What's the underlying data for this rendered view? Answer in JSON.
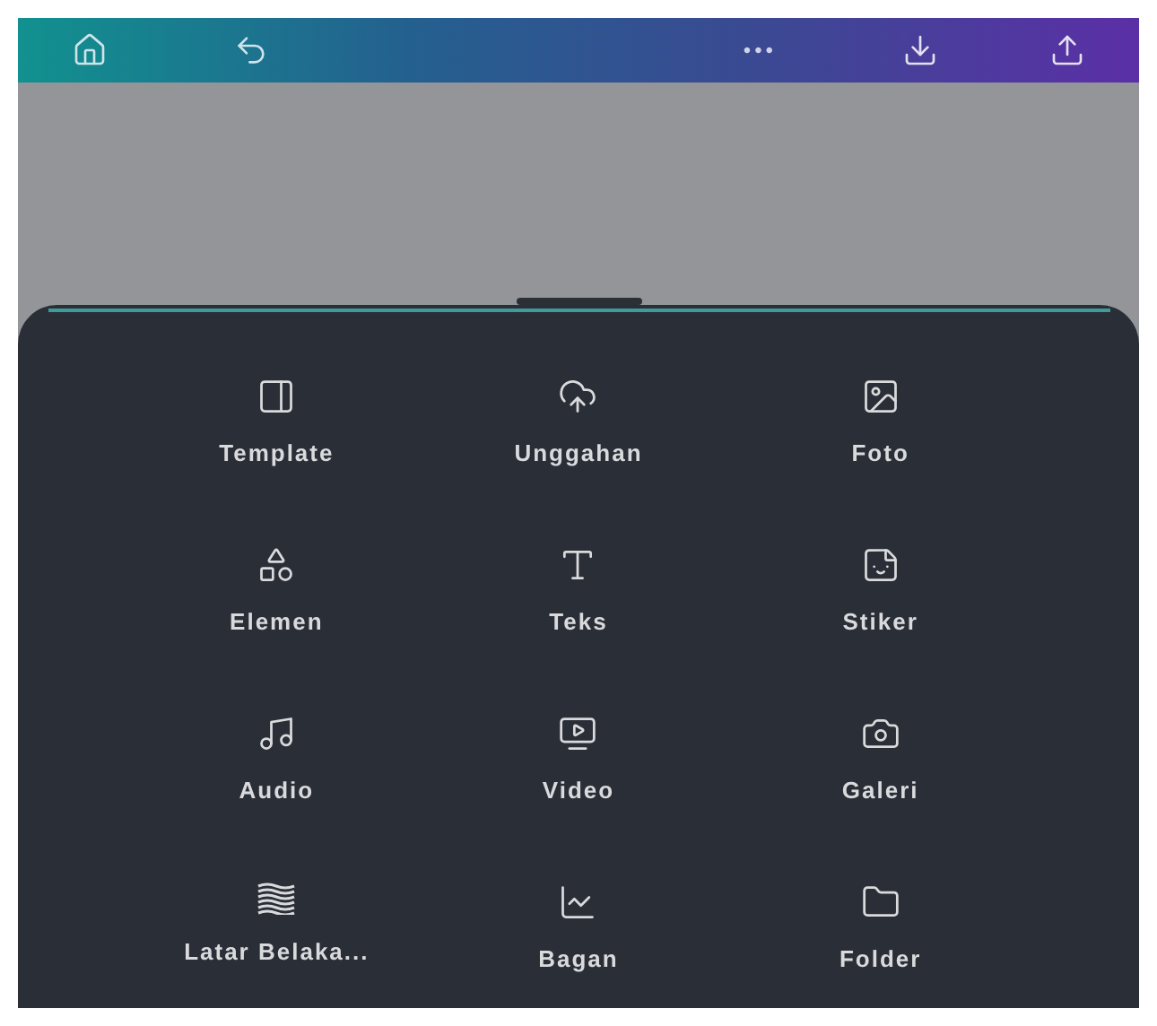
{
  "toolbar": {
    "more_menu": "•••"
  },
  "panel": {
    "items": [
      {
        "label": "Template"
      },
      {
        "label": "Unggahan"
      },
      {
        "label": "Foto"
      },
      {
        "label": "Elemen"
      },
      {
        "label": "Teks"
      },
      {
        "label": "Stiker"
      },
      {
        "label": "Audio"
      },
      {
        "label": "Video"
      },
      {
        "label": "Galeri"
      },
      {
        "label": "Latar Belaka..."
      },
      {
        "label": "Bagan"
      },
      {
        "label": "Folder"
      }
    ]
  }
}
